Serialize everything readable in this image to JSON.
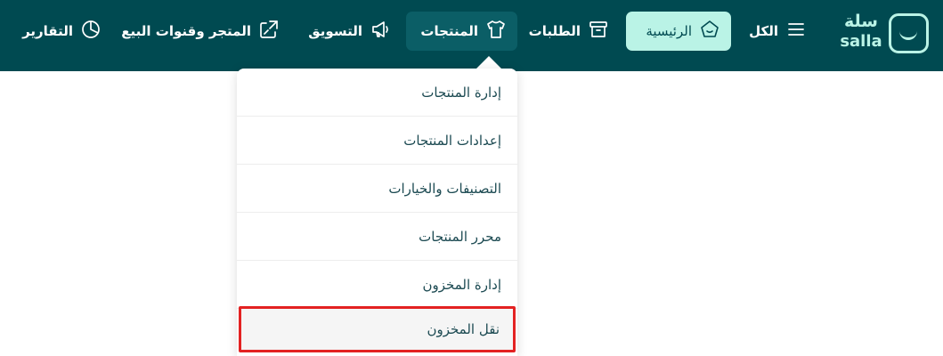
{
  "brand": {
    "name_ar": "سلة",
    "name_en": "salla",
    "color": "#004a51",
    "accent": "#baf3e6"
  },
  "nav": {
    "all": {
      "label": "الكل",
      "icon": "menu-icon"
    },
    "home": {
      "label": "الرئيسية",
      "icon": "home-icon"
    },
    "products": {
      "label": "المنتجات",
      "icon": "tshirt-icon"
    },
    "orders": {
      "label": "الطلبات",
      "icon": "archive-box-icon"
    },
    "marketing": {
      "label": "التسويق",
      "icon": "megaphone-icon"
    },
    "store_channels": {
      "label": "المتجر وقنوات البيع",
      "icon": "store-channels-icon"
    },
    "reports": {
      "label": "التقارير",
      "icon": "pie-chart-icon"
    }
  },
  "products_menu": {
    "items": [
      {
        "label": "إدارة المنتجات"
      },
      {
        "label": "إعدادات المنتجات"
      },
      {
        "label": "التصنيفات والخيارات"
      },
      {
        "label": "محرر المنتجات"
      },
      {
        "label": "إدارة المخزون"
      },
      {
        "label": "نقل المخزون"
      }
    ],
    "highlight_color": "#e32222"
  }
}
